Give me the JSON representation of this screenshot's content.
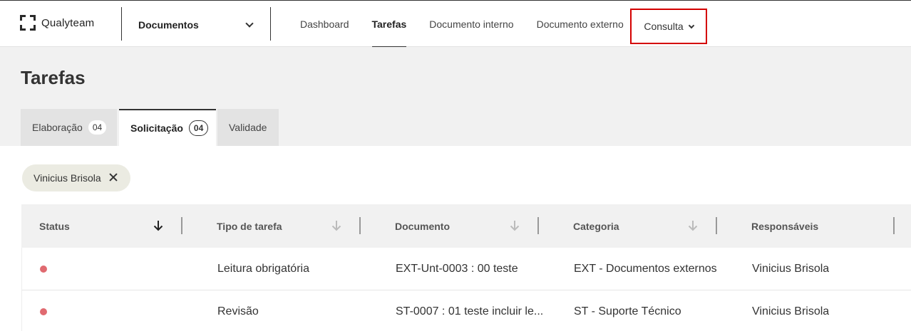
{
  "brand": {
    "name": "Qualyteam",
    "logo_icon": "qualyteam-logo-icon"
  },
  "module_selector": {
    "label": "Documentos"
  },
  "nav": {
    "items": [
      "Dashboard",
      "Tarefas",
      "Documento interno",
      "Documento externo"
    ],
    "active": "Tarefas",
    "consulta": "Consulta"
  },
  "page": {
    "title": "Tarefas"
  },
  "tabs": [
    {
      "label": "Elaboração",
      "count": "04"
    },
    {
      "label": "Solicitação",
      "count": "04"
    },
    {
      "label": "Validade",
      "count": ""
    }
  ],
  "filter_chip": {
    "label": "Vinicius Brisola"
  },
  "table": {
    "columns": [
      "Status",
      "Tipo de tarefa",
      "Documento",
      "Categoria",
      "Responsáveis"
    ],
    "rows": [
      {
        "status_color": "#e06a70",
        "tipo": "Leitura obrigatória",
        "documento": "EXT-Unt-0003 : 00 teste",
        "categoria": "EXT - Documentos externos",
        "responsaveis": "Vinicius Brisola"
      },
      {
        "status_color": "#e06a70",
        "tipo": "Revisão",
        "documento": "ST-0007 : 01 teste incluir le...",
        "categoria": "ST - Suporte Técnico",
        "responsaveis": "Vinicius Brisola"
      }
    ]
  },
  "colors": {
    "highlight_border": "#d40000",
    "status_pending": "#e06a70"
  }
}
